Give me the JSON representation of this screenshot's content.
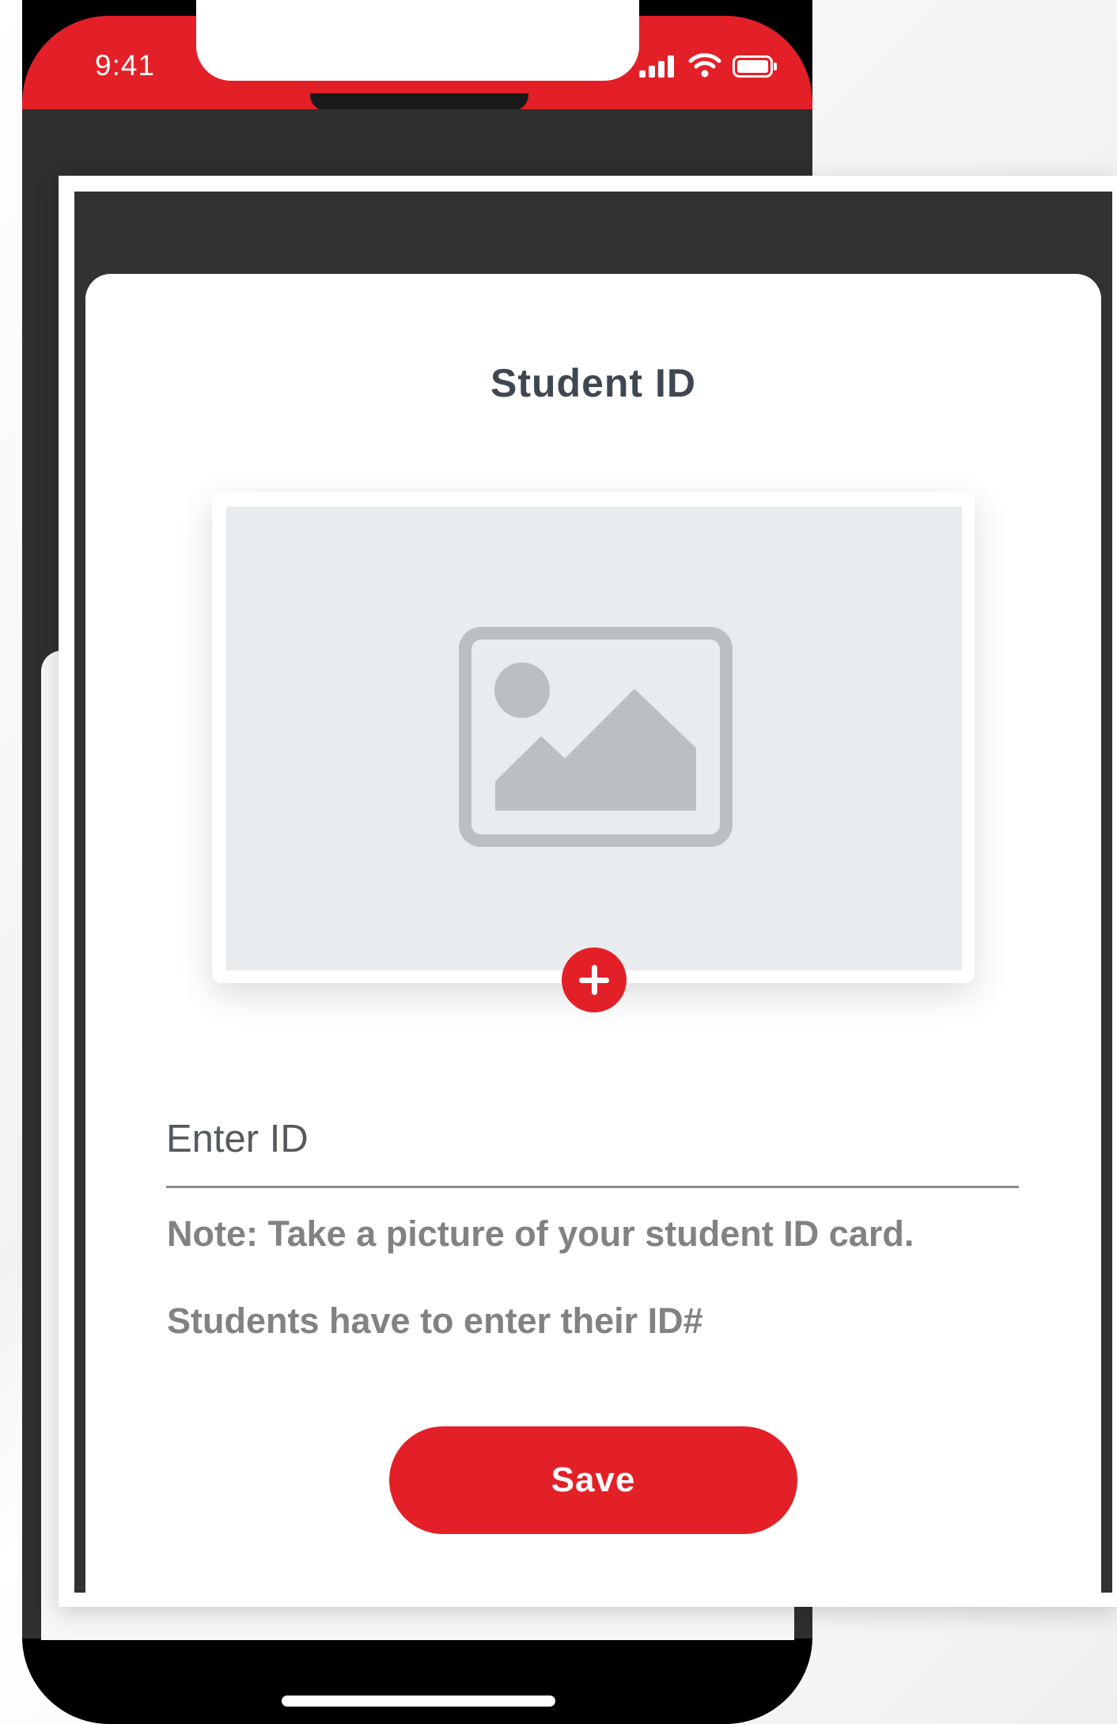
{
  "status_bar": {
    "time": "9:41",
    "signal_icon": "cellular-signal-icon",
    "wifi_icon": "wifi-icon",
    "battery_icon": "battery-icon"
  },
  "screen": {
    "title": "Student ID",
    "photo_placeholder_icon": "image-placeholder-icon",
    "add_photo_icon": "plus-icon",
    "id_input": {
      "placeholder": "Enter ID",
      "value": ""
    },
    "note": "Note: Take a picture of your student ID card.",
    "instruction": "Students have to enter their ID#",
    "save_label": "Save"
  },
  "colors": {
    "accent": "#e32027",
    "dark_background": "#323232",
    "title_text": "#3f4750",
    "secondary_text": "#828282",
    "photo_area": "#e8ecee",
    "placeholder_icon": "#bbbfc2"
  }
}
